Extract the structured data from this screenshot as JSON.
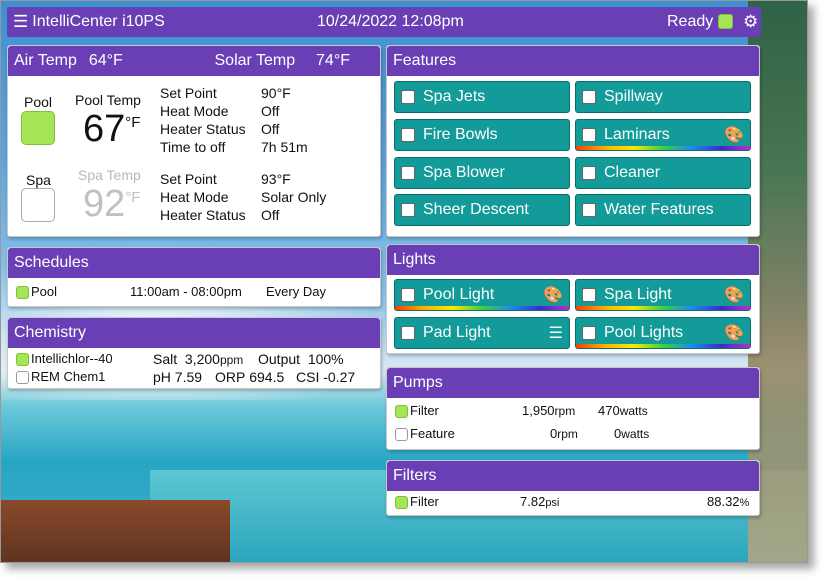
{
  "app": {
    "title": "IntelliCenter i10PS",
    "datetime": "10/24/2022 12:08pm",
    "status": "Ready"
  },
  "temps": {
    "air_label": "Air Temp",
    "air_value": "64°F",
    "solar_label": "Solar Temp",
    "solar_value": "74°F",
    "pool": {
      "label": "Pool",
      "temp_label": "Pool Temp",
      "temp": "67",
      "unit": "°F",
      "rows": [
        [
          "Set Point",
          "90°F"
        ],
        [
          "Heat Mode",
          "Off"
        ],
        [
          "Heater Status",
          "Off"
        ],
        [
          "Time to off",
          "7h 51m"
        ]
      ]
    },
    "spa": {
      "label": "Spa",
      "temp_label": "Spa Temp",
      "temp": "92",
      "unit": "°F",
      "rows": [
        [
          "Set Point",
          "93°F"
        ],
        [
          "Heat Mode",
          "Solar Only"
        ],
        [
          "Heater Status",
          "Off"
        ]
      ]
    }
  },
  "schedules": {
    "title": "Schedules",
    "items": [
      {
        "name": "Pool",
        "time": "11:00am - 08:00pm",
        "days": "Every Day"
      }
    ]
  },
  "chemistry": {
    "title": "Chemistry",
    "row1": {
      "name": "Intellichlor--40",
      "salt_label": "Salt",
      "salt": "3,200",
      "salt_unit": "ppm",
      "out_label": "Output",
      "out": "100%"
    },
    "row2": {
      "name": "REM Chem1",
      "ph_label": "pH",
      "ph": "7.59",
      "orp_label": "ORP",
      "orp": "694.5",
      "csi_label": "CSI",
      "csi": "-0.27"
    }
  },
  "features": {
    "title": "Features",
    "items": [
      "Spa Jets",
      "Spillway",
      "Fire Bowls",
      "Laminars",
      "Spa Blower",
      "Cleaner",
      "Sheer Descent",
      "Water Features"
    ]
  },
  "lights": {
    "title": "Lights",
    "items": [
      "Pool Light",
      "Spa Light",
      "Pad Light",
      "Pool Lights"
    ]
  },
  "pumps": {
    "title": "Pumps",
    "items": [
      {
        "name": "Filter",
        "rpm": "1,950",
        "watts": "470",
        "on": true
      },
      {
        "name": "Feature",
        "rpm": "0",
        "watts": "0",
        "on": false
      }
    ],
    "rpm_unit": "rpm",
    "watts_unit": "watts"
  },
  "filters": {
    "title": "Filters",
    "items": [
      {
        "name": "Filter",
        "psi": "7.82",
        "psi_unit": "psi",
        "pct": "88.32",
        "pct_unit": "%"
      }
    ]
  },
  "colors": {
    "header": "#6a3fb5",
    "button": "#129b99",
    "indicator_on": "#a4e655"
  },
  "icons": {
    "menu": "hamburger-icon",
    "settings": "gears-icon",
    "palette": "palette-icon",
    "sliders": "sliders-icon"
  }
}
